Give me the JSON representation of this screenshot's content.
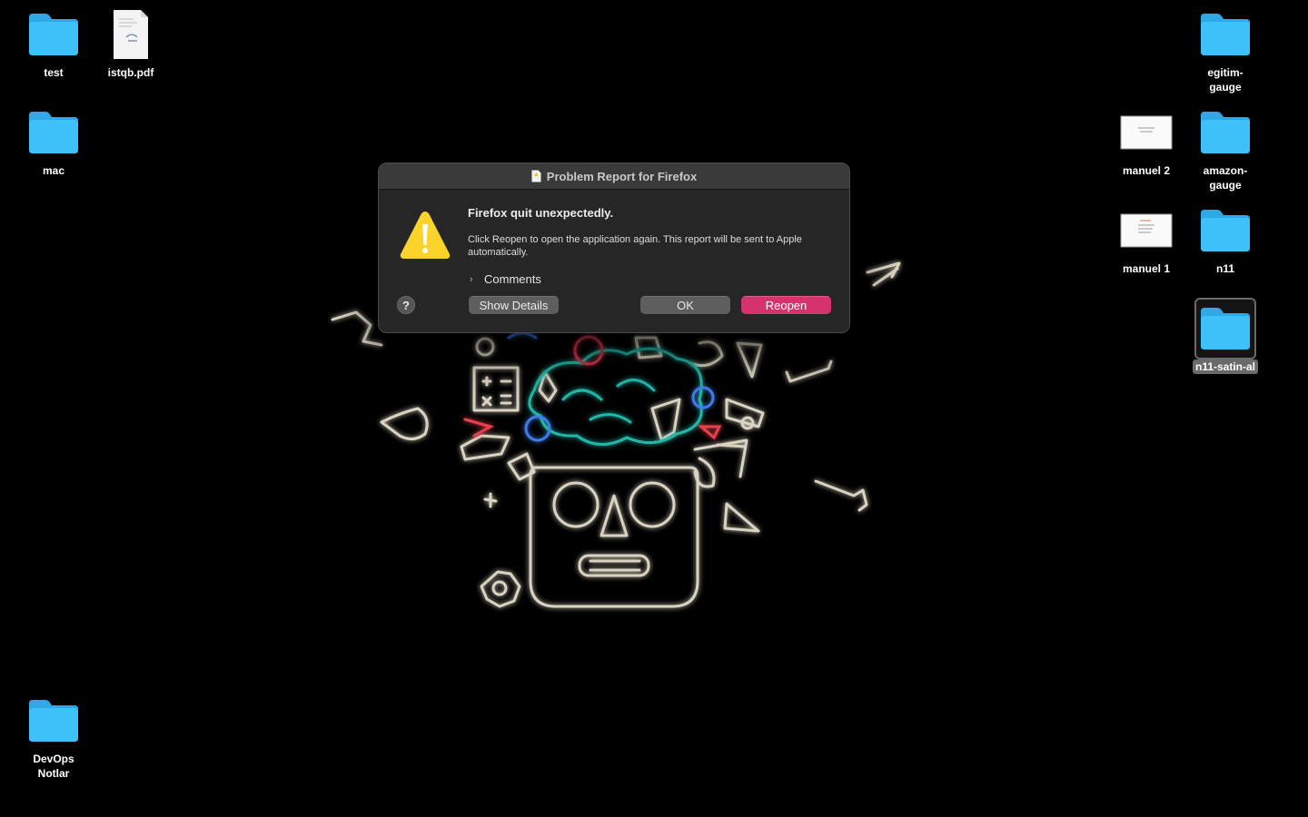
{
  "desktop": {
    "icons": [
      {
        "label": "test",
        "type": "folder"
      },
      {
        "label": "istqb.pdf",
        "type": "pdf-document"
      },
      {
        "label": "mac",
        "type": "folder"
      },
      {
        "label": "DevOps\nNotlar",
        "type": "folder"
      },
      {
        "label": "egitim-\ngauge",
        "type": "folder"
      },
      {
        "label": "manuel 2",
        "type": "screenshot-image"
      },
      {
        "label": "amazon-\ngauge",
        "type": "folder"
      },
      {
        "label": "manuel 1",
        "type": "screenshot-image"
      },
      {
        "label": "n11",
        "type": "folder"
      },
      {
        "label": "n11-satin-al",
        "type": "folder",
        "selected": true
      }
    ]
  },
  "dialog": {
    "title": "Problem Report for Firefox",
    "icon": "warning-icon",
    "headline": "Firefox quit unexpectedly.",
    "message": "Click Reopen to open the application again. This report will be sent to Apple automatically.",
    "comments_label": "Comments",
    "help_label": "?",
    "buttons": {
      "show_details": "Show Details",
      "ok": "OK",
      "reopen": "Reopen"
    }
  },
  "colors": {
    "desktop_background": "#000000",
    "folder_blue": "#3ec0f8",
    "accent_pink": "#d6336d",
    "dialog_background": "#262626"
  }
}
